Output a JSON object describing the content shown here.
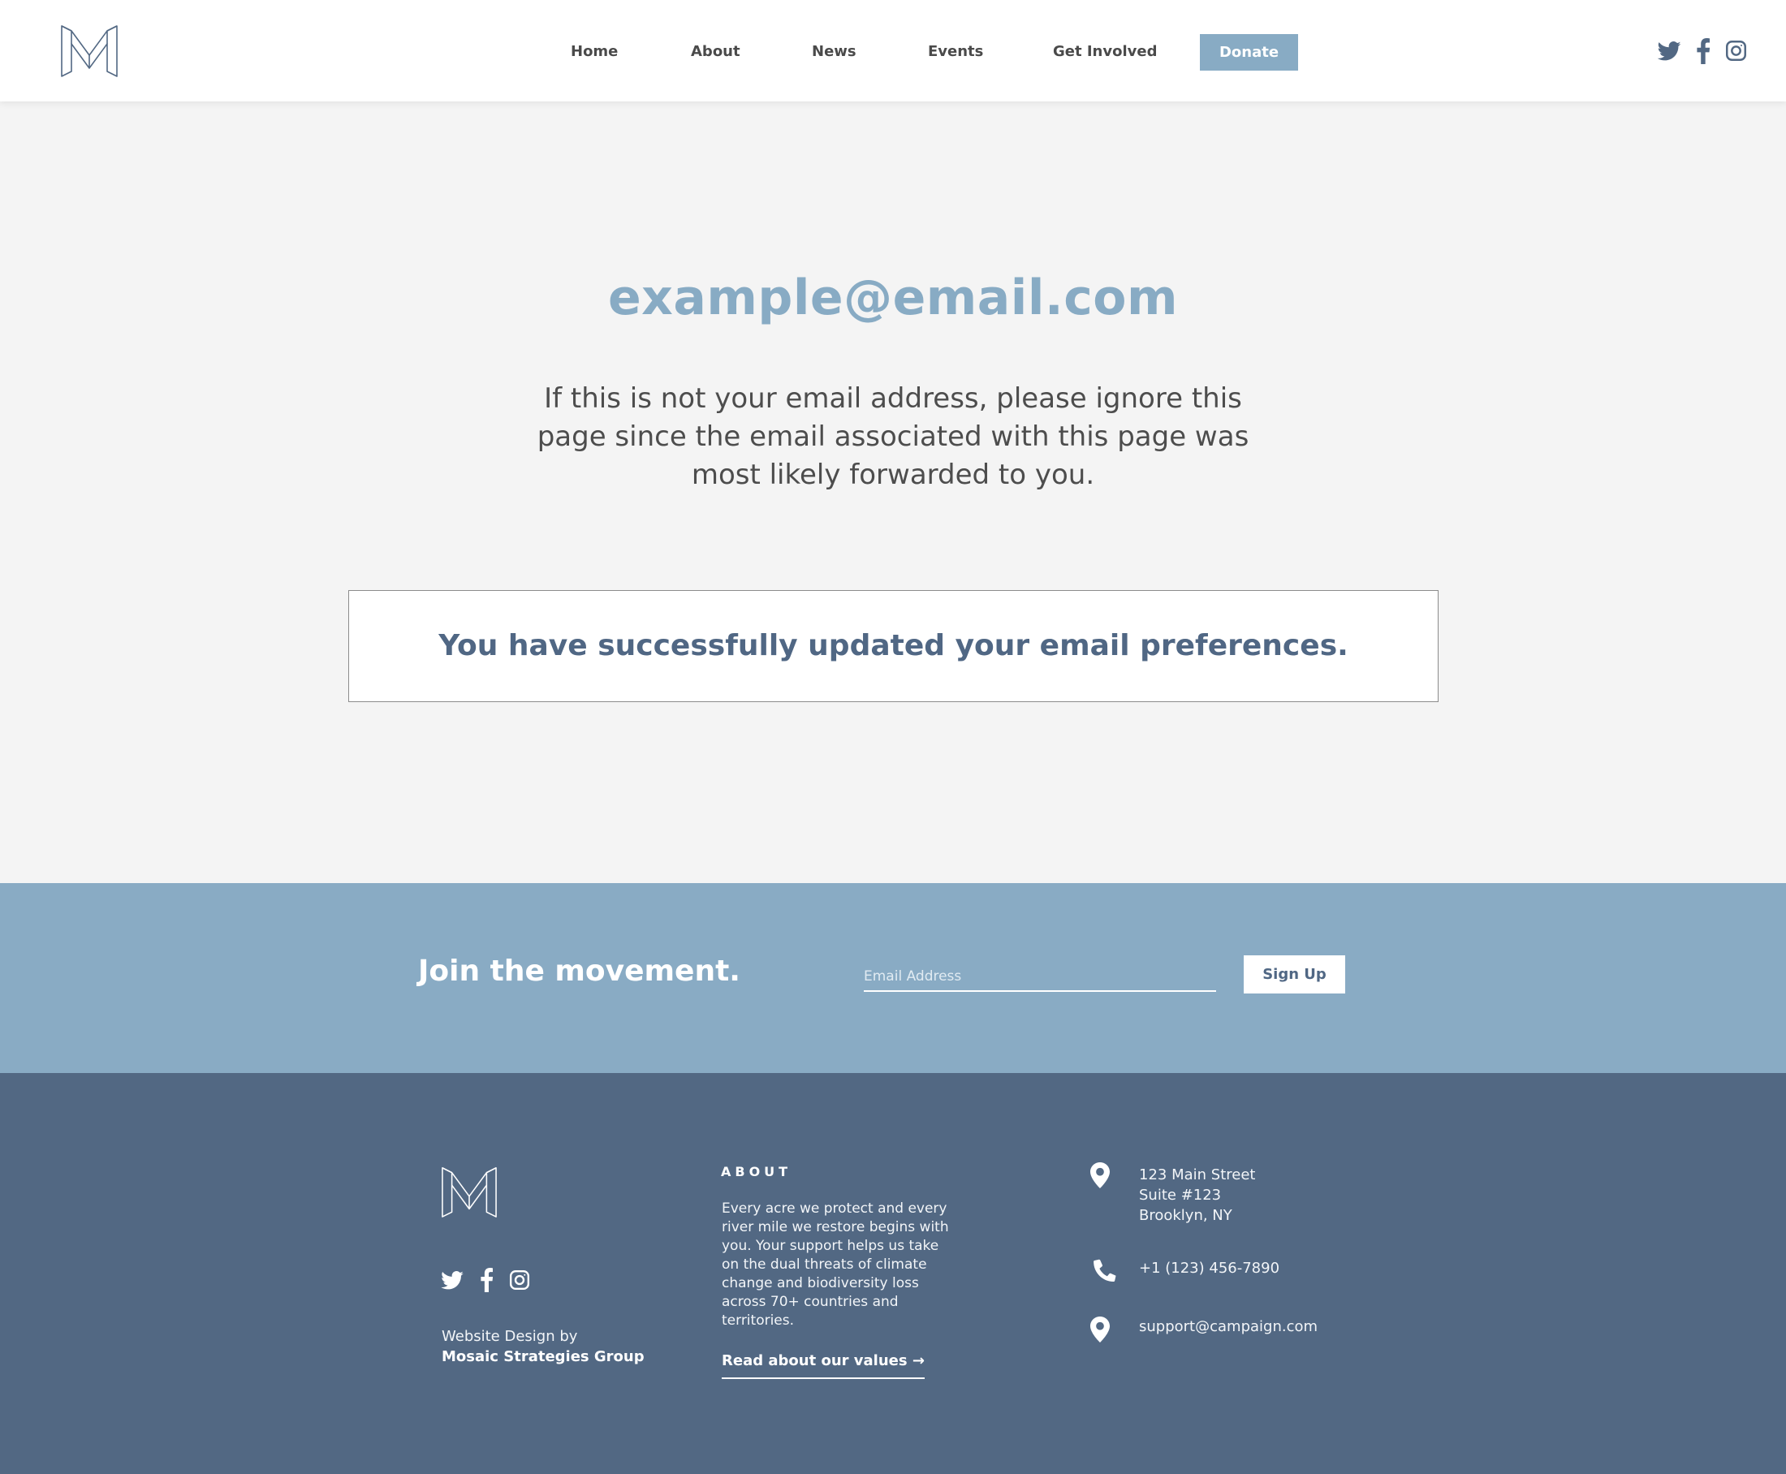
{
  "header": {
    "nav": [
      {
        "label": "Home"
      },
      {
        "label": "About"
      },
      {
        "label": "News"
      },
      {
        "label": "Events"
      },
      {
        "label": "Get Involved"
      }
    ],
    "donate_label": "Donate",
    "social_icons": [
      "twitter-icon",
      "facebook-icon",
      "instagram-icon"
    ]
  },
  "main": {
    "email": "example@email.com",
    "note_lines": [
      "If this is not your email address, please ignore this",
      "page since the email associated with this page was",
      "most likely forwarded to you."
    ],
    "success_message": "You have successfully updated your email preferences."
  },
  "signup": {
    "title": "Join the movement.",
    "email_placeholder": "Email Address",
    "email_value": "",
    "button_label": "Sign Up"
  },
  "footer": {
    "credit_line1": "Website Design by",
    "credit_line2": "Mosaic Strategies Group",
    "about_title": "ABOUT",
    "about_lines": [
      "Every acre we protect and every",
      "river mile we restore begins with",
      "you. Your support helps us take",
      "on the dual threats of climate",
      "change and biodiversity loss",
      "across 70+ countries and",
      "territories."
    ],
    "about_link": "Read about our values →",
    "address_lines": [
      "123 Main Street",
      "Suite #123",
      "Brooklyn, NY"
    ],
    "phone": "+1 (123) 456-7890",
    "email": "support@campaign.com"
  },
  "colors": {
    "accent": "#88abc4",
    "dark_blue": "#526883",
    "page_bg": "#f4f4f4"
  }
}
